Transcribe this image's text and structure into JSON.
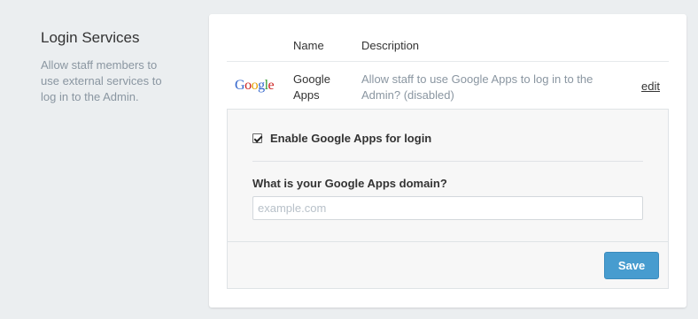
{
  "section": {
    "title": "Login Services",
    "description": "Allow staff members to use external services to log in to the Admin."
  },
  "table": {
    "headers": {
      "name": "Name",
      "description": "Description"
    },
    "row": {
      "logo_letters": [
        {
          "ch": "G",
          "color": "#3366cc"
        },
        {
          "ch": "o",
          "color": "#cc2222"
        },
        {
          "ch": "o",
          "color": "#e6a100"
        },
        {
          "ch": "g",
          "color": "#3366cc"
        },
        {
          "ch": "l",
          "color": "#339933"
        },
        {
          "ch": "e",
          "color": "#cc2222"
        }
      ],
      "name": "Google Apps",
      "description": "Allow staff to use Google Apps to log in to the Admin? (disabled)",
      "edit_label": "edit"
    }
  },
  "panel": {
    "checkbox_label": "Enable Google Apps for login",
    "checkbox_checked": true,
    "domain_label": "What is your Google Apps domain?",
    "domain_placeholder": "example.com",
    "domain_value": "",
    "save_label": "Save"
  }
}
